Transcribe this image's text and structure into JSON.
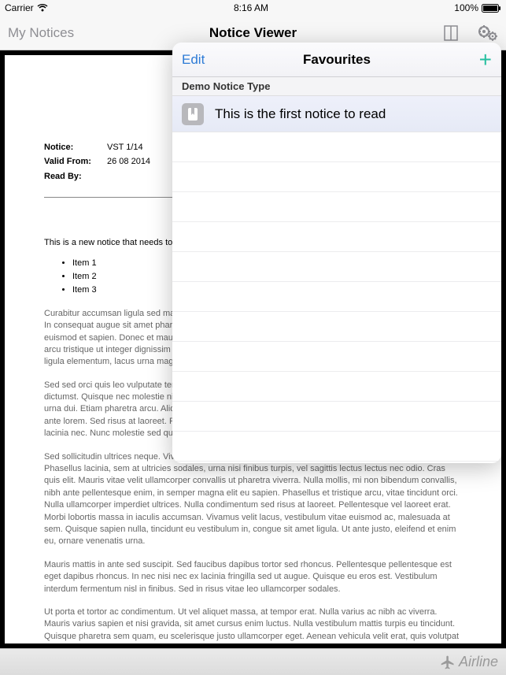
{
  "status": {
    "carrier": "Carrier",
    "time": "8:16 AM",
    "battery": "100%"
  },
  "nav": {
    "back": "My Notices",
    "title": "Notice Viewer"
  },
  "document": {
    "meta": {
      "notice_label": "Notice:",
      "notice_value": "VST 1/14",
      "valid_label": "Valid From:",
      "valid_value": "26 08 2014",
      "readby_label": "Read By:",
      "readby_value": ""
    },
    "intro": "This is a new notice that needs to be read.",
    "items": [
      "Item 1",
      "Item 2",
      "Item 3"
    ],
    "para1": "Curabitur accumsan ligula sed magna placerat auctor ipsum sed ut massa tristique dui eget tincidunt massa. In consequat augue sit amet pharetra viverra, nulla lectus malesuada, consectetur eget sapien tortor, euismod et sapien. Donec et mauris a mauris tempus elementum commodo erat feugiat a. Quisque erat sed arcu tristique ut integer dignissim sem mi, nec lacinia diam efficitur ut. Cras pretium in arcu tempor. In vel ligula elementum, lacus urna magna. Vestibulum porta dui nec felis.",
    "para2": "Sed sed orci quis leo vulputate tempor. Proin in nunc urna vulputate ultrices. Nunc vitae consectetur et dictumst. Quisque nec molestie nisi. Donec urna est, in sagittis porta sed, dictum sed urna. Maecenas ut urna dui. Etiam pharetra arcu. Aliquam tempor sed urna porttitor sed euismod et. Suspendisse venenatis ante lorem. Sed risus at laoreet. Pellentesque vel laoreet erat. Morbi Etiam tristique erat felis, vitae quam lacinia nec. Nunc molestie sed quam sed. In mollis malesuada tortor, sed vulputate.",
    "para3": "Sed sollicitudin ultrices neque. Vivamus facilisis ut. Nunc ultrices maximus orci, in fermentum metus. Phasellus lacinia, sem at ultricies sodales, urna nisi finibus turpis, vel sagittis lectus lectus nec odio. Cras quis elit. Mauris vitae velit ullamcorper convallis ut pharetra viverra. Nulla mollis, mi non bibendum convallis, nibh ante pellentesque enim, in semper magna elit eu sapien. Phasellus et tristique arcu, vitae tincidunt orci. Nulla ullamcorper imperdiet ultrices. Nulla condimentum sed risus at laoreet. Pellentesque vel laoreet erat. Morbi lobortis massa in iaculis accumsan. Vivamus velit lacus, vestibulum vitae euismod ac, malesuada at sem. Quisque sapien nulla, tincidunt eu vestibulum in, congue sit amet ligula. Ut ante justo, eleifend et enim eu, ornare venenatis urna.",
    "para4": "Mauris mattis in ante sed suscipit. Sed faucibus dapibus tortor sed rhoncus. Pellentesque pellentesque est eget dapibus rhoncus. In nec nisi nec ex lacinia fringilla sed ut augue. Quisque eu eros est. Vestibulum interdum fermentum nisl in finibus. Sed in risus vitae leo ullamcorper sodales.",
    "para5": "Ut porta et tortor ac condimentum. Ut vel aliquet massa, at tempor erat. Nulla varius ac nibh ac viverra. Mauris varius sapien et nisi gravida, sit amet cursus enim luctus. Nulla vestibulum mattis turpis eu tincidunt. Quisque pharetra sem quam, eu scelerisque justo ullamcorper eget. Aenean vehicula velit erat, quis volutpat eros venenatis eget. Sed lacinia sem id ex venenatis, id tincidunt turpis viverra. Praesent vulputate varius elit at sollicitudin. Vestibulum ultricies, arcu at molestie ultrices, quam lectus faucibus nibh, tincidunt placerat ex enim"
  },
  "popover": {
    "edit": "Edit",
    "title": "Favourites",
    "section": "Demo Notice Type",
    "row1": "This is the first notice to read"
  },
  "brand": "Airline"
}
